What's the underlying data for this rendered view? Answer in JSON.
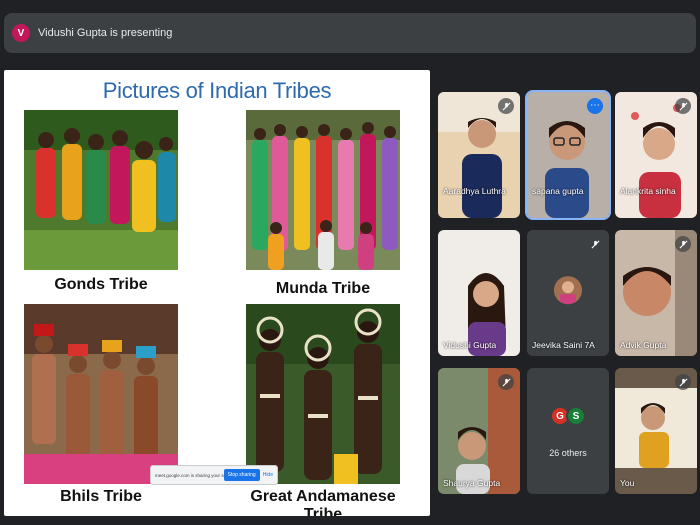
{
  "presenter": {
    "avatar_letter": "V",
    "text": "Vidushi Gupta is presenting"
  },
  "slide": {
    "title": "Pictures of Indian Tribes",
    "tribes": [
      {
        "caption": "Gonds Tribe"
      },
      {
        "caption": "Munda Tribe"
      },
      {
        "caption": "Bhils Tribe"
      },
      {
        "caption": "Great Andamanese Tribe"
      }
    ],
    "share_banner": {
      "message": "meet.google.com is sharing your screen.",
      "stop_label": "Stop sharing",
      "hide_label": "Hide"
    }
  },
  "participants": [
    {
      "name": "Aaradhya Luthra"
    },
    {
      "name": "sapana gupta"
    },
    {
      "name": "Alankrita sinha"
    },
    {
      "name": "Vidushi Gupta"
    },
    {
      "name": "Jeevika Saini 7A"
    },
    {
      "name": "Advik Gupta"
    },
    {
      "name": "Shaurya Gupta"
    },
    {
      "name": "26 others",
      "avatars": [
        "G",
        "S"
      ]
    },
    {
      "name": "You"
    }
  ],
  "colors": {
    "background": "#202124",
    "accent": "#1a73e8",
    "active_outline": "#8ab4f8",
    "title_blue": "#2e6ab0"
  }
}
